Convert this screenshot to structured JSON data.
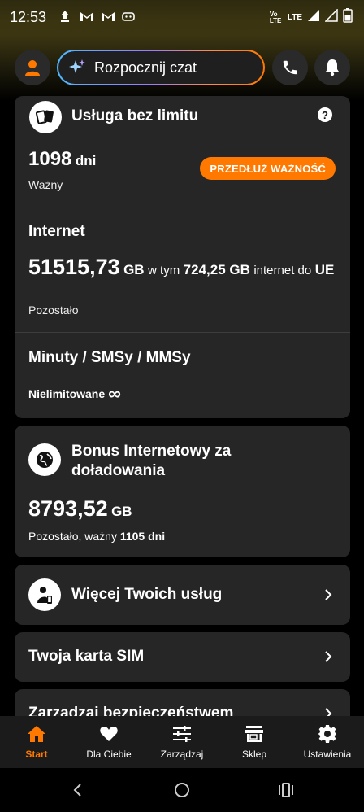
{
  "status_bar": {
    "time": "12:53",
    "network_label": "LTE",
    "volte_label": "Vo LTE"
  },
  "header": {
    "chat_placeholder": "Rozpocznij czat",
    "icons": [
      "avatar-icon",
      "sparkle-icon",
      "phone-icon",
      "bell-icon"
    ]
  },
  "plan_card": {
    "title": "Usługa bez limitu",
    "validity_days": "1098",
    "validity_unit": "dni",
    "validity_status": "Ważny",
    "extend_button": "PRZEDŁUŻ WAŻNOŚĆ",
    "internet_title": "Internet",
    "internet_amount": "51515,73",
    "internet_unit": "GB",
    "internet_incl_prefix": "w tym",
    "internet_eu_amount": "724,25 GB",
    "internet_eu_suffix": "internet do",
    "internet_eu_region": "UE",
    "internet_remaining": "Pozostało",
    "minutes_title": "Minuty / SMSy / MMSy",
    "minutes_value": "Nielimitowane",
    "minutes_symbol": "∞"
  },
  "bonus_card": {
    "title_line1": "Bonus Internetowy za",
    "title_line2": "doładowania",
    "amount": "8793,52",
    "unit": "GB",
    "remaining_prefix": "Pozostało, ważny",
    "remaining_days": "1105 dni"
  },
  "more_services": {
    "label": "Więcej Twoich usług"
  },
  "sim_card": {
    "label": "Twoja karta SIM"
  },
  "security": {
    "label": "Zarządzaj bezpieczeństwem"
  },
  "bottom_nav": {
    "items": [
      {
        "label": "Start",
        "icon": "home-icon",
        "active": true
      },
      {
        "label": "Dla Ciebie",
        "icon": "heart-icon",
        "active": false
      },
      {
        "label": "Zarządzaj",
        "icon": "sliders-icon",
        "active": false
      },
      {
        "label": "Sklep",
        "icon": "store-icon",
        "active": false
      },
      {
        "label": "Ustawienia",
        "icon": "gear-icon",
        "active": false
      }
    ]
  },
  "colors": {
    "accent": "#ff7900",
    "card_bg": "#262626",
    "background": "#000000"
  }
}
